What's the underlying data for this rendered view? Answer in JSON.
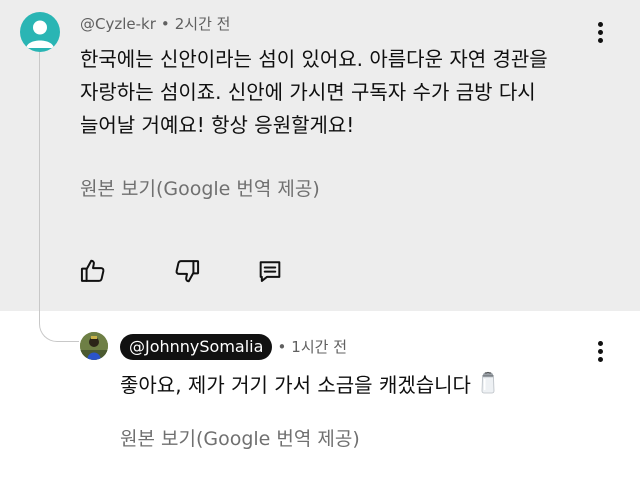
{
  "top_comment": {
    "handle": "@Cyzle-kr",
    "separator": "•",
    "time": "2시간 전",
    "text_lines": [
      "한국에는 신안이라는 섬이 있어요. 아름다운 자연 경관을",
      "자랑하는 섬이죠. 신안에 가시면 구독자 수가 금방 다시",
      "늘어날 거예요! 항상 응원할게요!"
    ],
    "translate_label": "원본 보기(Google 번역 제공)",
    "actions": {
      "like_icon": "thumbs-up-icon",
      "dislike_icon": "thumbs-down-icon",
      "reply_icon": "comment-reply-icon"
    },
    "avatar_color": "#2ab5b4"
  },
  "reply_comment": {
    "handle": "@JohnnySomalia",
    "separator": "•",
    "time": "1시간 전",
    "text": "좋아요, 제가 거기 가서 소금을 캐겠습니다",
    "emoji_icon": "salt-shaker-icon",
    "translate_label": "원본 보기(Google 번역 제공)"
  },
  "colors": {
    "top_background": "#ededed",
    "reply_background": "#ffffff",
    "handle_badge": "#111111",
    "secondary_text": "#606060"
  },
  "menu_icon": "more-vertical-icon"
}
